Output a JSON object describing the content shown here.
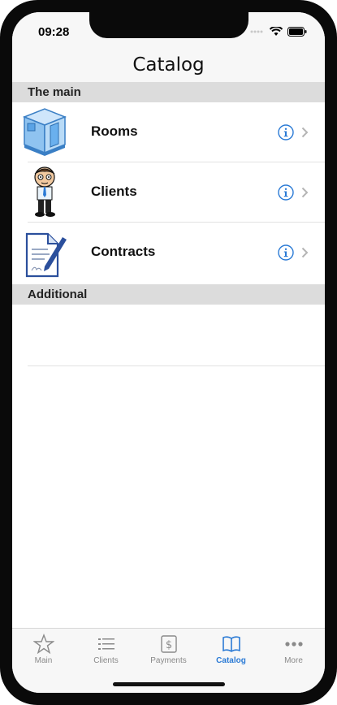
{
  "status_bar": {
    "time": "09:28"
  },
  "nav": {
    "title": "Catalog"
  },
  "sections": [
    {
      "title": "The main",
      "rows": [
        {
          "label": "Rooms",
          "icon": "room-icon"
        },
        {
          "label": "Clients",
          "icon": "client-character-icon"
        },
        {
          "label": "Contracts",
          "icon": "contract-document-icon"
        }
      ]
    },
    {
      "title": "Additional",
      "rows": []
    }
  ],
  "tabs": [
    {
      "label": "Main",
      "icon": "star-icon",
      "active": false
    },
    {
      "label": "Clients",
      "icon": "list-icon",
      "active": false
    },
    {
      "label": "Payments",
      "icon": "dollar-icon",
      "active": false
    },
    {
      "label": "Catalog",
      "icon": "book-icon",
      "active": true
    },
    {
      "label": "More",
      "icon": "ellipsis-icon",
      "active": false
    }
  ],
  "colors": {
    "accent": "#2a7ad5",
    "section_bg": "#dcdcdc"
  }
}
